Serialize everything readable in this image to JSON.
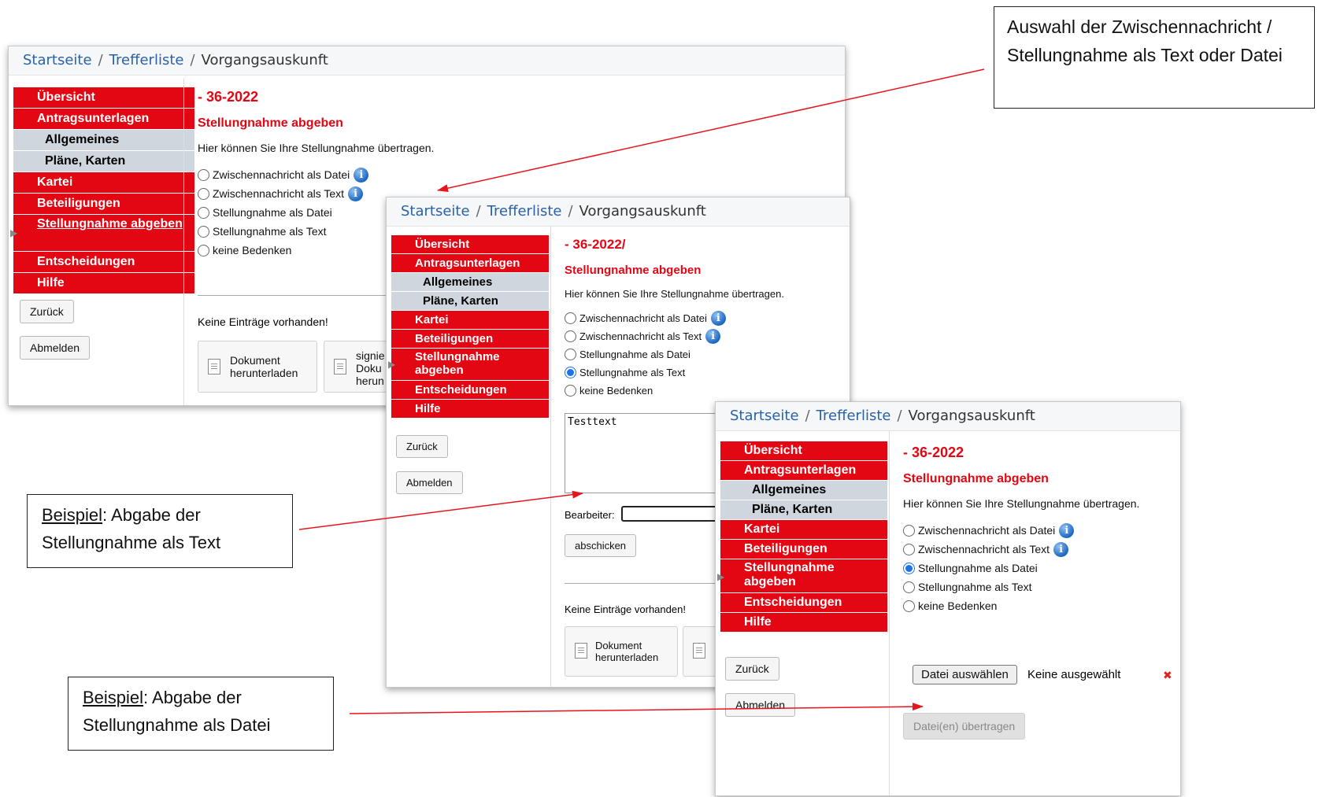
{
  "breadcrumb": {
    "home": "Startseite",
    "sep": "/",
    "results": "Trefferliste",
    "current": "Vorgangsauskunft"
  },
  "sidebar": {
    "items": [
      "Übersicht",
      "Antragsunterlagen",
      "Allgemeines",
      "Pläne, Karten",
      "Kartei",
      "Beteiligungen",
      "Stellungnahme abgeben",
      "Entscheidungen",
      "Hilfe"
    ],
    "back": "Zurück",
    "logout": "Abmelden"
  },
  "form": {
    "heading": "Stellungnahme abgeben",
    "intro": "Hier können Sie Ihre Stellungnahme übertragen.",
    "options": [
      "Zwischennachricht als Datei",
      "Zwischennachricht als Text",
      "Stellungnahme als Datei",
      "Stellungnahme als Text",
      "keine Bedenken"
    ],
    "no_entries": "Keine Einträge vorhanden!",
    "download_doc": "Dokument herunterladen",
    "signed_doc_partial": "signie Doku herun",
    "info_glyph": "i"
  },
  "panel1": {
    "case_no": "- 36-2022"
  },
  "panel2": {
    "case_no": "- 36-2022/",
    "textarea_value": "Testtext",
    "editor_label": "Bearbeiter:",
    "submit": "abschicken"
  },
  "panel3": {
    "case_no": "- 36-2022",
    "choose_file": "Datei auswählen",
    "no_file": "Keine ausgewählt",
    "remove_glyph": "✖",
    "upload": "Datei(en) übertragen"
  },
  "callouts": {
    "top": "Auswahl der Zwischennachricht / Stellungnahme als Text oder Datei",
    "example_label": "Beispiel",
    "text_rest": ": Abgabe der Stellungnahme als Text",
    "file_rest": ": Abgabe der Stellungnahme als Datei"
  },
  "colors": {
    "nav_red": "#e30613",
    "nav_sub": "#d0d6de",
    "link_blue": "#2a62a8",
    "arrow_red": "#e8141c"
  }
}
